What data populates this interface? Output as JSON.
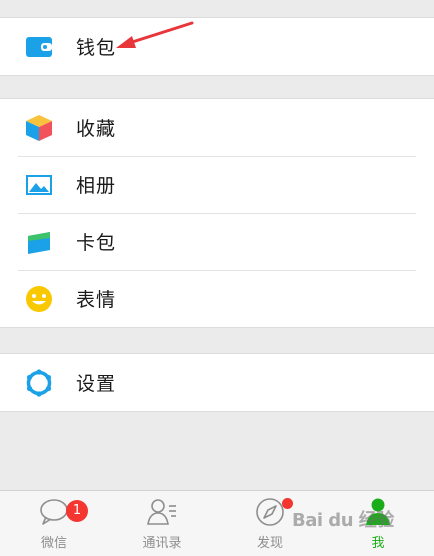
{
  "menu": {
    "wallet": {
      "label": "钱包",
      "icon": "wallet-icon"
    },
    "favorites": {
      "label": "收藏",
      "icon": "favorites-cube-icon"
    },
    "album": {
      "label": "相册",
      "icon": "album-image-icon"
    },
    "cards": {
      "label": "卡包",
      "icon": "card-pack-icon"
    },
    "stickers": {
      "label": "表情",
      "icon": "smiley-icon"
    },
    "settings": {
      "label": "设置",
      "icon": "gear-icon"
    }
  },
  "tabbar": {
    "chats": {
      "label": "微信",
      "badge": "1",
      "icon": "chat-bubble-icon"
    },
    "contacts": {
      "label": "通讯录",
      "icon": "contacts-icon"
    },
    "discover": {
      "label": "发现",
      "icon": "compass-icon",
      "has_dot": true
    },
    "me": {
      "label": "我",
      "icon": "person-icon",
      "active": true
    }
  },
  "colors": {
    "accent_blue": "#1aa1e8",
    "active_green": "#1aad19",
    "badge_red": "#f43530",
    "annotation_red": "#e8363a"
  },
  "watermark": {
    "text": "Bai du 经验"
  }
}
